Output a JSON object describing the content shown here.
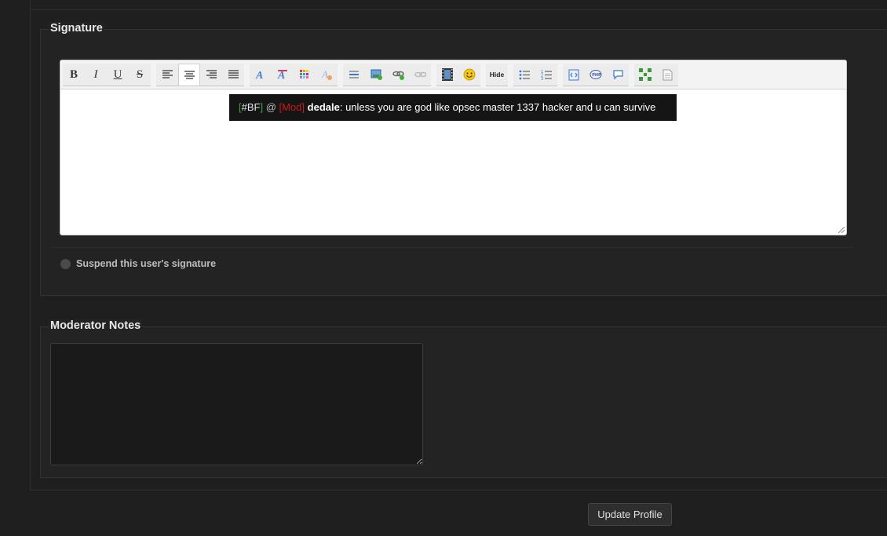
{
  "signature_section": {
    "legend": "Signature",
    "toolbar": {
      "bold": "B",
      "italic": "I",
      "underline": "U",
      "strike": "S",
      "hide": "Hide"
    },
    "content": {
      "prefix_open": "[",
      "tag": "#BF",
      "prefix_close": "]",
      "at": " @ ",
      "role": "[Mod]",
      "username": "dedale",
      "message": ": unless you are god like opsec master 1337 hacker and u can survive"
    },
    "suspend_label": "Suspend this user's signature"
  },
  "moderator_section": {
    "legend": "Moderator Notes",
    "notes_value": ""
  },
  "update_button": "Update Profile"
}
